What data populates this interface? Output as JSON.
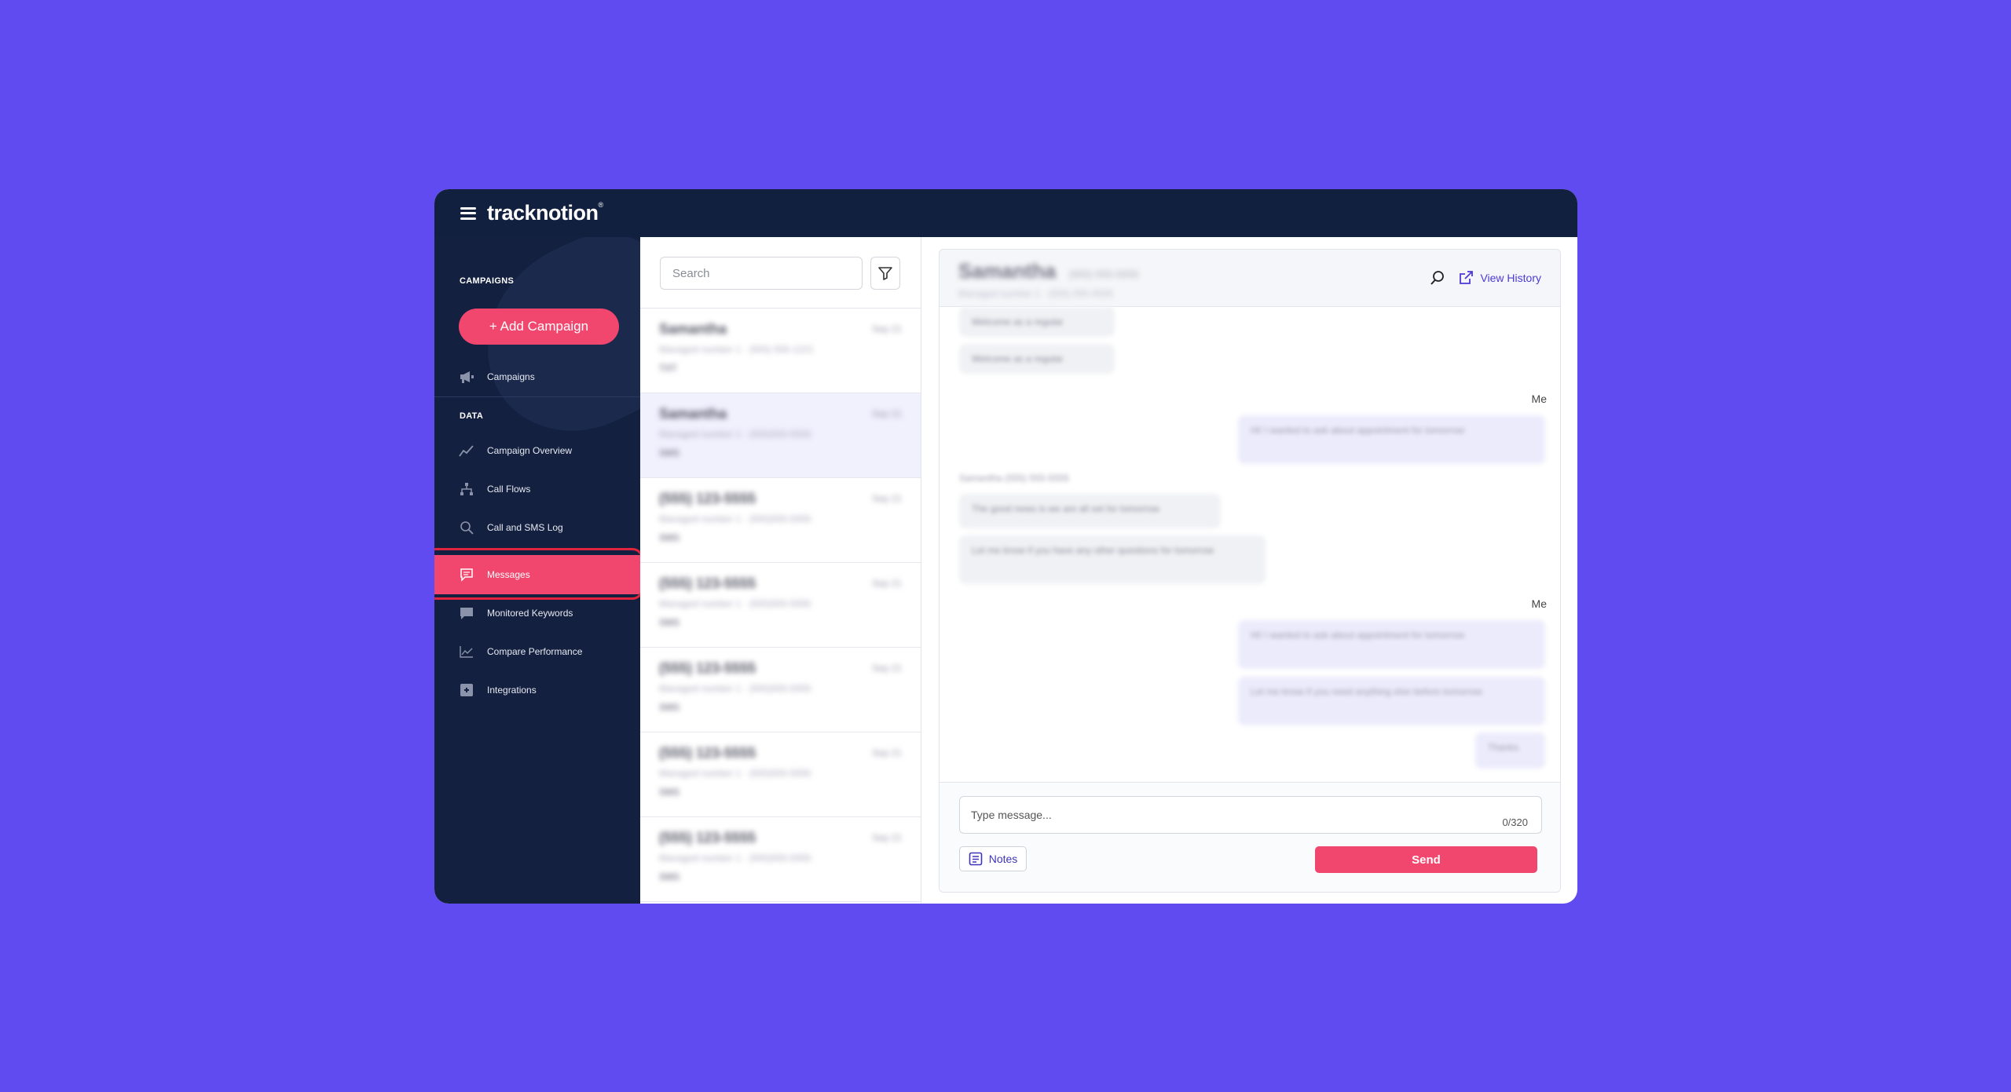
{
  "app": {
    "logo": "tracknotion",
    "logo_mark": "®"
  },
  "colors": {
    "background": "#5f4bf0",
    "navy": "#12203f",
    "accent": "#f1466e",
    "link": "#4b3ad6",
    "highlight_ring": "#e0243e"
  },
  "sidebar": {
    "campaigns_heading": "CAMPAIGNS",
    "add_campaign": "+ Add Campaign",
    "campaigns_item": "Campaigns",
    "data_heading": "DATA",
    "items": [
      {
        "label": "Campaign Overview",
        "icon": "line-chart-icon"
      },
      {
        "label": "Call Flows",
        "icon": "flow-icon"
      },
      {
        "label": "Call and SMS Log",
        "icon": "search-icon"
      },
      {
        "label": "Messages",
        "icon": "message-icon",
        "active": true
      },
      {
        "label": "Monitored Keywords",
        "icon": "chat-icon"
      },
      {
        "label": "Compare Performance",
        "icon": "area-chart-icon"
      },
      {
        "label": "Integrations",
        "icon": "plugin-icon"
      }
    ]
  },
  "list": {
    "search_placeholder": "Search",
    "conversations": [
      {
        "name": "Samantha",
        "date": "Sep 21",
        "sub": "Managed number 1 · (555) 555-1221",
        "tag": "TXT"
      },
      {
        "name": "Samantha",
        "date": "Sep 21",
        "sub": "Managed number 1 · (555)555-5555",
        "tag": "SMS"
      },
      {
        "name": "(555) 123-5555",
        "date": "Sep 21",
        "sub": "Managed number 1 · (555)555-5555",
        "tag": "SMS"
      },
      {
        "name": "(555) 123-5555",
        "date": "Sep 21",
        "sub": "Managed number 1 · (555)555-5555",
        "tag": "SMS"
      },
      {
        "name": "(555) 123-5555",
        "date": "Sep 21",
        "sub": "Managed number 1 · (555)555-5555",
        "tag": "SMS"
      },
      {
        "name": "(555) 123-5555",
        "date": "Sep 21",
        "sub": "Managed number 1 · (555)555-5555",
        "tag": "SMS"
      },
      {
        "name": "(555) 123-5555",
        "date": "Sep 21",
        "sub": "Managed number 1 · (555)555-5555",
        "tag": "SMS"
      }
    ]
  },
  "chat": {
    "contact_name": "Samantha",
    "contact_number": "(555) 555-5555",
    "contact_sub": "Managed number 1 · (555) 555-5555",
    "view_history": "View History",
    "me_label": "Me",
    "bubbles_in_top": [
      "Welcome as a regular",
      "Welcome as a regular"
    ],
    "bubble_out_1": "Hi! I wanted to ask about appointment for tomorrow",
    "sender_line": "Samantha (555) 555-5555",
    "bubbles_in_mid": [
      "The good news is we are all set for tomorrow",
      "Let me know if you have any other questions for tomorrow"
    ],
    "bubbles_out_2": [
      "Hi! I wanted to ask about appointment for tomorrow",
      "Let me know if you need anything else before tomorrow",
      "Thanks"
    ],
    "input_placeholder": "Type message...",
    "counter": "0/320",
    "notes": "Notes",
    "send": "Send"
  }
}
